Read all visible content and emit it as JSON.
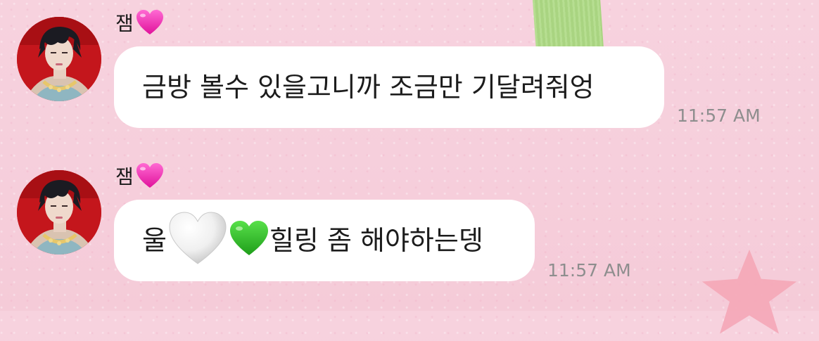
{
  "messages": [
    {
      "sender": "잼",
      "sender_emoji": "pink-heart-icon",
      "text": "금방 볼수 있을고니까 조금만 기달려줘엉",
      "time": "11:57 AM"
    },
    {
      "sender": "잼",
      "sender_emoji": "pink-heart-icon",
      "text_before": "울",
      "emojis": [
        "white-heart-icon",
        "green-heart-icon"
      ],
      "text_after": "힐링 좀 해야하는뎅",
      "time": "11:57 AM"
    }
  ],
  "colors": {
    "background": "#f6cfdc",
    "bubble": "#ffffff",
    "timestamp": "#8e8e8e",
    "pink_heart": "#ff3fbf",
    "green_heart": "#36c22a"
  }
}
